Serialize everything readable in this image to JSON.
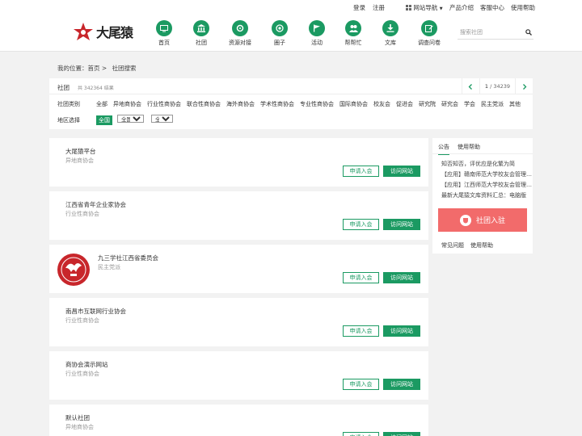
{
  "top_links": {
    "login": "登录",
    "register": "注册",
    "site_nav": "网站导航",
    "products": "产品介绍",
    "support": "客服中心",
    "help": "使用帮助"
  },
  "logo": {
    "text": "大尾猿"
  },
  "nav": [
    {
      "label": "首页",
      "icon": "monitor-icon"
    },
    {
      "label": "社团",
      "icon": "building-icon"
    },
    {
      "label": "资源对接",
      "icon": "gear-icon"
    },
    {
      "label": "圈子",
      "icon": "circle-icon"
    },
    {
      "label": "活动",
      "icon": "flag-icon"
    },
    {
      "label": "帮帮忙",
      "icon": "people-icon"
    },
    {
      "label": "文库",
      "icon": "download-icon"
    },
    {
      "label": "调查问卷",
      "icon": "edit-icon"
    }
  ],
  "search": {
    "placeholder": "搜索社团"
  },
  "breadcrumb": {
    "prefix": "我的位置：",
    "home": "首页 >",
    "current": "社团搜索"
  },
  "filter": {
    "title": "社团",
    "count": "共 342364 结果",
    "page_current": "1",
    "page_total": "/ 34239",
    "category_label": "社团类别",
    "categories": [
      "全部",
      "异地商协会",
      "行业性商协会",
      "联合性商协会",
      "海外商协会",
      "学术性商协会",
      "专业性商协会",
      "国际商协会",
      "校友会",
      "促进会",
      "研究院",
      "研究会",
      "学会",
      "民主党派",
      "其他"
    ],
    "region_label": "地区选择",
    "region_all": "全国",
    "select1": "全国",
    "select2": "全省"
  },
  "cards": [
    {
      "name": "大尾猿平台",
      "type": "异地商协会"
    },
    {
      "name": "江西省青年企业家协会",
      "type": "行业性商协会"
    },
    {
      "name": "九三学社江西省委员会",
      "type": "民主党派"
    },
    {
      "name": "南昌市互联网行业协会",
      "type": "行业性商协会"
    },
    {
      "name": "商协会演示网站",
      "type": "行业性商协会"
    },
    {
      "name": "默认社团",
      "type": "异地商协会"
    }
  ],
  "card_buttons": {
    "join": "申请入会",
    "visit": "访问网站"
  },
  "sidebar": {
    "tab_notice": "公告",
    "tab_help": "使用帮助",
    "news": [
      "知否知否，评优应是化繁为简",
      "【应用】赣南师范大学校友会管理平台上线",
      "【应用】江西师范大学校友会管理平台上线",
      "最新大尾猿文库资料汇总：电脑版"
    ],
    "register_button": "社团入驻",
    "faq": "常见问题",
    "usage_help": "使用帮助"
  },
  "colors": {
    "brand_green": "#1b9a62",
    "accent_red": "#f26b6b",
    "logo_red": "#c8262b"
  }
}
